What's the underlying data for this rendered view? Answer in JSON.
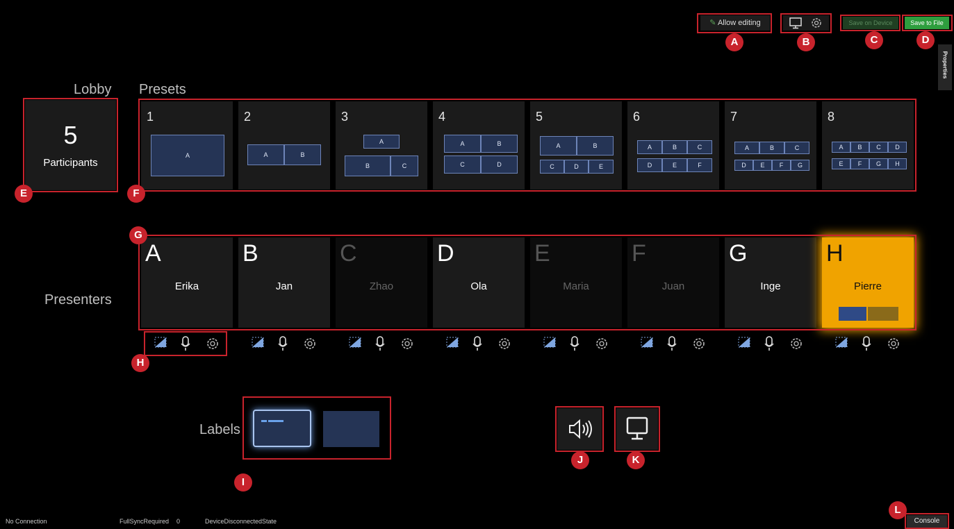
{
  "toolbar": {
    "allow_editing": "Allow editing",
    "save_on_device": "Save on Device",
    "save_to_file": "Save to File",
    "properties_tab": "Properties"
  },
  "lobby": {
    "title": "Lobby",
    "count": "5",
    "label": "Participants"
  },
  "presets": {
    "title": "Presets",
    "items": [
      {
        "number": "1",
        "boxes": [
          "A"
        ]
      },
      {
        "number": "2",
        "boxes": [
          "A",
          "B"
        ]
      },
      {
        "number": "3",
        "boxes": [
          "A",
          "B",
          "C"
        ]
      },
      {
        "number": "4",
        "boxes": [
          "A",
          "B",
          "C",
          "D"
        ]
      },
      {
        "number": "5",
        "boxes": [
          "A",
          "B",
          "C",
          "D",
          "E"
        ]
      },
      {
        "number": "6",
        "boxes": [
          "A",
          "B",
          "C",
          "D",
          "E",
          "F"
        ]
      },
      {
        "number": "7",
        "boxes": [
          "A",
          "B",
          "C",
          "D",
          "E",
          "F",
          "G"
        ]
      },
      {
        "number": "8",
        "boxes": [
          "A",
          "B",
          "C",
          "D",
          "E",
          "F",
          "G",
          "H"
        ]
      }
    ]
  },
  "presenters": {
    "title": "Presenters",
    "items": [
      {
        "letter": "A",
        "name": "Erika",
        "state": "active"
      },
      {
        "letter": "B",
        "name": "Jan",
        "state": "active"
      },
      {
        "letter": "C",
        "name": "Zhao",
        "state": "inactive"
      },
      {
        "letter": "D",
        "name": "Ola",
        "state": "active"
      },
      {
        "letter": "E",
        "name": "Maria",
        "state": "inactive"
      },
      {
        "letter": "F",
        "name": "Juan",
        "state": "inactive"
      },
      {
        "letter": "G",
        "name": "Inge",
        "state": "active"
      },
      {
        "letter": "H",
        "name": "Pierre",
        "state": "selected"
      }
    ]
  },
  "labels": {
    "title": "Labels"
  },
  "markers": [
    "A",
    "B",
    "C",
    "D",
    "E",
    "F",
    "G",
    "H",
    "I",
    "J",
    "K",
    "L"
  ],
  "status": {
    "connection": "No Connection",
    "sync_label": "FullSyncRequired",
    "sync_value": "0",
    "device_state": "DeviceDisconnectedState"
  },
  "console_button": "Console",
  "colors": {
    "marker_red": "#c8232c",
    "save_green": "#2e9e3e",
    "selected_orange": "#f0a300",
    "preset_blue": "#253455"
  }
}
